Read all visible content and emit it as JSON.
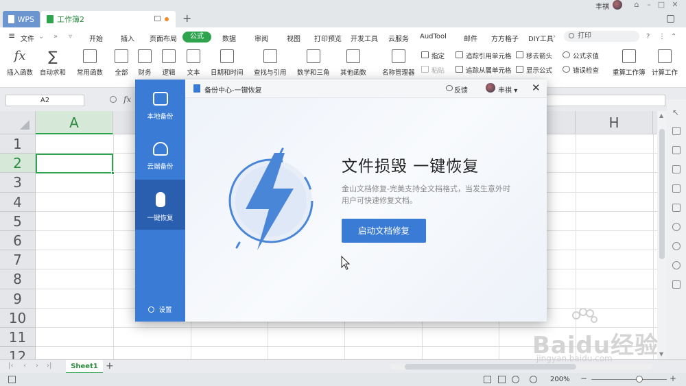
{
  "titlebar": {
    "tab_wps": "WPS",
    "tab_doc": "工作簿2",
    "add_tab": "+",
    "user_name": "丰祺"
  },
  "menu": {
    "file": "文件",
    "items": [
      "开始",
      "插入",
      "页面布局",
      "公式",
      "数据",
      "审阅",
      "视图",
      "打印预览",
      "开发工具",
      "云服务",
      "AudTool",
      "邮件",
      "方方格子",
      "DIY工具"
    ],
    "active": "公式",
    "search_placeholder": "打印"
  },
  "ribbon": {
    "big": [
      "插入函数",
      "自动求和",
      "常用函数",
      "全部",
      "财务",
      "逻辑",
      "文本",
      "日期和时间",
      "查找与引用",
      "数学和三角",
      "其他函数",
      "名称管理器",
      "重算工作簿",
      "计算工作"
    ],
    "small": {
      "specify": "指定",
      "paste": "粘贴",
      "trace_precedents": "追踪引用单元格",
      "trace_dependents": "追踪从属单元格",
      "remove_arrows": "移去箭头",
      "show_formulas": "显示公式",
      "evaluate": "公式求值",
      "error_check": "错误检查"
    },
    "fx_symbol": "fx",
    "sum_symbol": "∑"
  },
  "formula_bar": {
    "cell_ref": "A2",
    "fx": "fx"
  },
  "grid": {
    "columns": [
      "A",
      "H"
    ],
    "rows": [
      "1",
      "2",
      "3",
      "4",
      "5",
      "6",
      "7",
      "8",
      "9",
      "10",
      "11",
      "12"
    ],
    "selected_cell": "A2"
  },
  "sheets": {
    "tabs": [
      "Sheet1"
    ],
    "add": "+"
  },
  "statusbar": {
    "zoom": "200%",
    "minus": "−",
    "plus": "+"
  },
  "dialog": {
    "title": "备份中心-一键恢复",
    "feedback": "反馈",
    "user": "丰祺",
    "close": "✕",
    "sidebar": [
      "本地备份",
      "云端备份",
      "一键恢复"
    ],
    "active_sidebar": "一键恢复",
    "settings": "设置",
    "headline": "文件损毁 一键恢复",
    "description": "金山文档修复-完美支持全文档格式，当发生意外时用户可快速修复文档。",
    "button": "启动文档修复"
  },
  "watermark": {
    "brand": "Baidu经验",
    "url": "jingyan.baidu.com"
  },
  "colors": {
    "accent_green": "#2ea44f",
    "dialog_blue": "#3a7bd5",
    "wps_tab": "#6a95cf"
  }
}
